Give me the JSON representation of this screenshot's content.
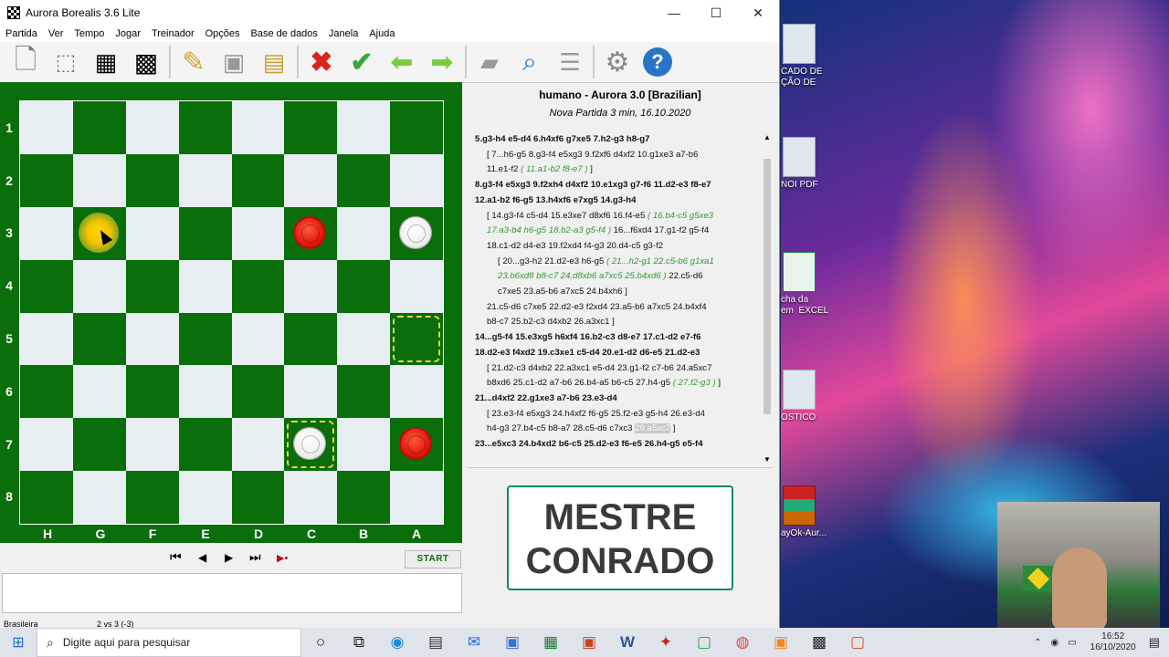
{
  "window": {
    "title": "Aurora Borealis 3.6 Lite",
    "minimize": "—",
    "maximize": "☐",
    "close": "✕"
  },
  "menu": [
    "Partida",
    "Ver",
    "Tempo",
    "Jogar",
    "Treinador",
    "Opções",
    "Base de dados",
    "Janela",
    "Ajuda"
  ],
  "toolbar": {
    "icons": [
      "new-game-icon",
      "setup-position-icon",
      "board-icon",
      "checkerboard-icon",
      "edit-icon",
      "save-icon",
      "save-as-icon",
      "cancel-icon",
      "confirm-icon",
      "back-icon",
      "forward-icon",
      "book-icon",
      "search-icon",
      "database-icon",
      "settings-icon",
      "help-icon"
    ],
    "colors": {
      "cancel": "#d8261c",
      "confirm": "#3aa73a",
      "arrows": "#7bcc3a",
      "help": "#2a74c8"
    }
  },
  "board": {
    "row_labels": [
      "1",
      "2",
      "3",
      "4",
      "5",
      "6",
      "7",
      "8"
    ],
    "col_labels": [
      "H",
      "G",
      "F",
      "E",
      "D",
      "C",
      "B",
      "A"
    ],
    "light_color": "#e7eef1",
    "dark_color": "#0a6e0a"
  },
  "controls": {
    "start_label": "START",
    "first": "⏮",
    "prev": "◀",
    "next": "▶",
    "last": "⏭",
    "end": "▶•"
  },
  "notation": {
    "title": "humano - Aurora 3.0 [Brazilian]",
    "subtitle": "Nova Partida 3 min, 16.10.2020",
    "lines": [
      {
        "style": "b",
        "text": "5.g3-h4 e5-d4 6.h4xf6 g7xe5 7.h2-g3 h8-g7"
      },
      {
        "style": "ind",
        "text": "[ 7...h6-g5 8.g3-f4 e5xg3 9.f2xf6 d4xf2 10.g1xe3 a7-b6"
      },
      {
        "style": "ind",
        "text": "11.e1-f2",
        "green": "( 11.a1-b2 f8-e7 )",
        "after": " ]"
      },
      {
        "style": "b",
        "text": "8.g3-f4 e5xg3 9.f2xh4 d4xf2 10.e1xg3 g7-f6 11.d2-e3 f8-e7"
      },
      {
        "style": "b",
        "text": "12.a1-b2 f6-g5 13.h4xf6 e7xg5 14.g3-h4"
      },
      {
        "style": "ind",
        "text": "[ 14.g3-f4 c5-d4 15.e3xe7 d8xf6 16.f4-e5",
        "green": "( 16.b4-c5 g5xe3",
        "after": ""
      },
      {
        "style": "ind",
        "text": "",
        "green": "17.a3-b4 h6-g5 18.b2-a3 g5-f4 )",
        "after": " 16...f6xd4 17.g1-f2 g5-f4"
      },
      {
        "style": "ind",
        "text": "18.c1-d2 d4-e3 19.f2xd4 f4-g3 20.d4-c5 g3-f2"
      },
      {
        "style": "ind2",
        "text": "[ 20...g3-h2 21.d2-e3 h6-g5",
        "green": "( 21...h2-g1 22.c5-b6 g1xa1",
        "after": ""
      },
      {
        "style": "ind2",
        "text": "",
        "green": "23.b6xd8 b8-c7 24.d8xb6 a7xc5 25.b4xd6 )",
        "after": " 22.c5-d6"
      },
      {
        "style": "ind2",
        "text": "c7xe5 23.a5-b6 a7xc5 24.b4xh6 ]"
      },
      {
        "style": "ind",
        "text": "21.c5-d6 c7xe5 22.d2-e3 f2xd4 23.a5-b6 a7xc5 24.b4xf4"
      },
      {
        "style": "ind",
        "text": "b8-c7 25.b2-c3 d4xb2 26.a3xc1 ]"
      },
      {
        "style": "b",
        "text": "14...g5-f4 15.e3xg5 h6xf4 16.b2-c3 d8-e7 17.c1-d2 e7-f6"
      },
      {
        "style": "b",
        "text": "18.d2-e3 f4xd2 19.c3xe1 c5-d4 20.e1-d2 d6-e5 21.d2-e3"
      },
      {
        "style": "ind",
        "text": "[ 21.d2-c3 d4xb2 22.a3xc1 e5-d4 23.g1-f2 c7-b6 24.a5xc7"
      },
      {
        "style": "ind",
        "text": "b8xd6 25.c1-d2 a7-b6 26.b4-a5 b6-c5 27.h4-g5",
        "green": "( 27.f2-g3 )",
        "after": " ]"
      },
      {
        "style": "b",
        "text": "21...d4xf2 22.g1xe3 a7-b6 23.e3-d4"
      },
      {
        "style": "ind",
        "text": "[ 23.e3-f4 e5xg3 24.h4xf2 f6-g5 25.f2-e3 g5-h4 26.e3-d4"
      },
      {
        "style": "ind",
        "text": "h4-g3 27.b4-c5 b8-a7 28.c5-d6 c7xc3",
        "hl": "29.a5xc7",
        "after": " ]"
      },
      {
        "style": "b",
        "text": "23...e5xc3 24.b4xd2 b6-c5 25.d2-e3 f6-e5 26.h4-g5 e5-f4"
      }
    ]
  },
  "banner": {
    "line1": "MESTRE",
    "line2": "CONRADO"
  },
  "status": {
    "left": "Brasileira",
    "score": "2 vs 3  (-3)"
  },
  "desktop_icons": [
    {
      "label": "CADO DE\nÇÃO DE",
      "kind": "doc"
    },
    {
      "label": "NOI PDF",
      "kind": "doc"
    },
    {
      "label": "cha da\nem  EXCEL",
      "kind": "xl"
    },
    {
      "label": "OSTICO",
      "kind": "doc"
    },
    {
      "label": "ayOk-Aur...",
      "kind": "rar"
    }
  ],
  "taskbar": {
    "search_placeholder": "Digite aqui para pesquisar",
    "apps": [
      "cortana-icon",
      "task-view-icon",
      "edge-icon",
      "store-icon",
      "mail-icon",
      "photos-icon",
      "excel-icon",
      "powerpoint-icon",
      "word-icon",
      "filezilla-icon",
      "camtasia-green-icon",
      "chrome-icon",
      "orange-app-icon",
      "checkers-icon",
      "camtasia-red-icon"
    ],
    "time": "16:52",
    "date": "16/10/2020"
  }
}
